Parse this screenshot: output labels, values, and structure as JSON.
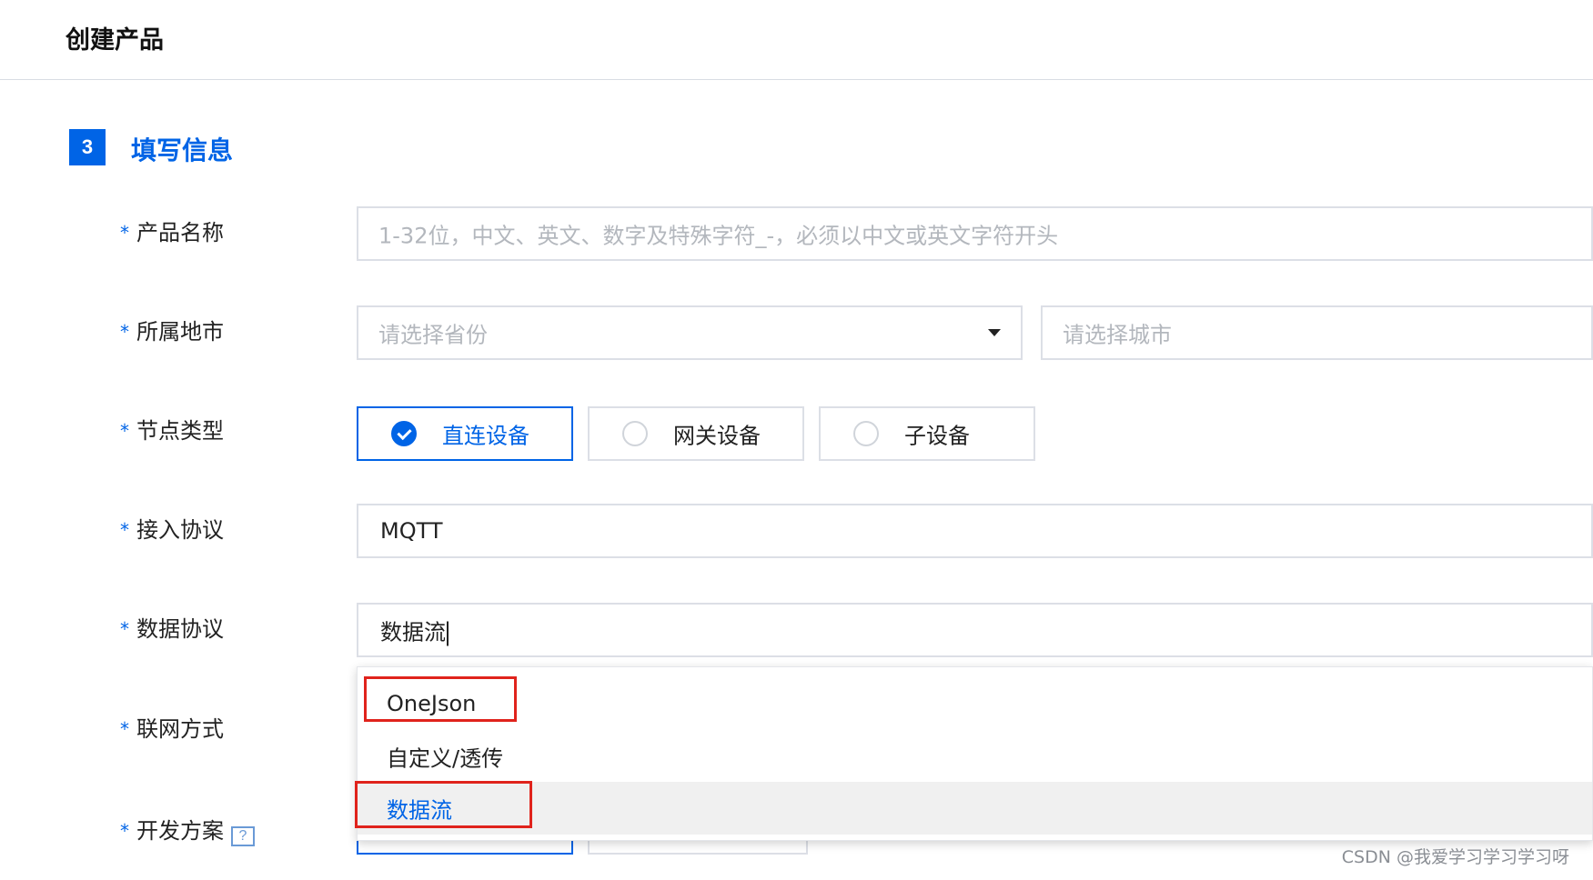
{
  "header": {
    "title": "创建产品"
  },
  "section": {
    "step_number": "3",
    "title": "填写信息"
  },
  "form": {
    "required_mark": "*",
    "product_name": {
      "label": "产品名称",
      "placeholder": "1-32位，中文、英文、数字及特殊字符_-，必须以中文或英文字符开头"
    },
    "region": {
      "label": "所属地市",
      "province_placeholder": "请选择省份",
      "city_placeholder": "请选择城市"
    },
    "node_type": {
      "label": "节点类型",
      "options": [
        {
          "label": "直连设备",
          "selected": true
        },
        {
          "label": "网关设备",
          "selected": false
        },
        {
          "label": "子设备",
          "selected": false
        }
      ]
    },
    "access_protocol": {
      "label": "接入协议",
      "value": "MQTT"
    },
    "data_protocol": {
      "label": "数据协议",
      "value": "数据流",
      "options": [
        {
          "label": "OneJson",
          "highlighted": false
        },
        {
          "label": "自定义/透传",
          "highlighted": false
        },
        {
          "label": "数据流",
          "highlighted": true
        }
      ]
    },
    "network_mode": {
      "label": "联网方式"
    },
    "dev_plan": {
      "label": "开发方案",
      "help": "?"
    }
  },
  "watermark": "CSDN @我爱学习学习学习呀",
  "colors": {
    "accent": "#0064e6",
    "annotation_red": "#e0231c",
    "border": "#dcdfe6",
    "placeholder": "#b3b7bd"
  },
  "icons": [
    "select-arrow-icon",
    "check-icon",
    "radio-circle-icon",
    "help-icon"
  ]
}
